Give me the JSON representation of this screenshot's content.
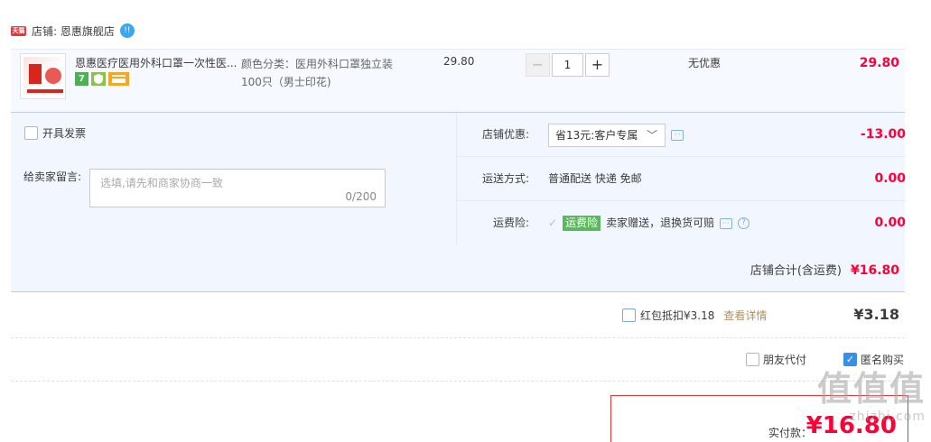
{
  "shop": {
    "badge": "天猫",
    "name": "店铺: 恩惠旗舰店",
    "chat_badge": "!!"
  },
  "item": {
    "title": "恩惠医疗医用外科口罩一次性医...",
    "sku": "颜色分类：医用外科口罩独立装100只（男士印花)",
    "price": "29.80",
    "qty": "1",
    "promo": "无优惠",
    "subtotal": "29.80",
    "service_icons": [
      "7",
      "shield",
      "card"
    ]
  },
  "order": {
    "invoice_label": "开具发票",
    "message_label": "给卖家留言:",
    "message_placeholder": "选填,请先和商家协商一致",
    "message_count": "0/200",
    "coupon": {
      "label": "店铺优惠:",
      "selected": "省13元:客户专属",
      "amount": "-13.00"
    },
    "shipping": {
      "label": "运送方式:",
      "value": "普通配送 快递 免邮",
      "amount": "0.00"
    },
    "insurance": {
      "label": "运费险:",
      "badge": "运费险",
      "value": "卖家赠送，退换货可赔",
      "amount": "0.00"
    },
    "shop_total_label": "店铺合计(含运费)",
    "shop_total": "¥16.80"
  },
  "redpacket": {
    "label": "红包抵扣¥3.18",
    "link": "查看详情",
    "amount": "¥3.18"
  },
  "options": {
    "friend_pay": "朋友代付",
    "anonymous": "匿名购买"
  },
  "payment": {
    "label": "实付款：",
    "amount": "¥16.80"
  },
  "watermark": {
    "big": "值值值",
    "small": "zhizhi.com"
  },
  "colors": {
    "accent": "#ff0036",
    "brand_border": "#e4393c",
    "panel_bg": "#f2f7ff"
  }
}
